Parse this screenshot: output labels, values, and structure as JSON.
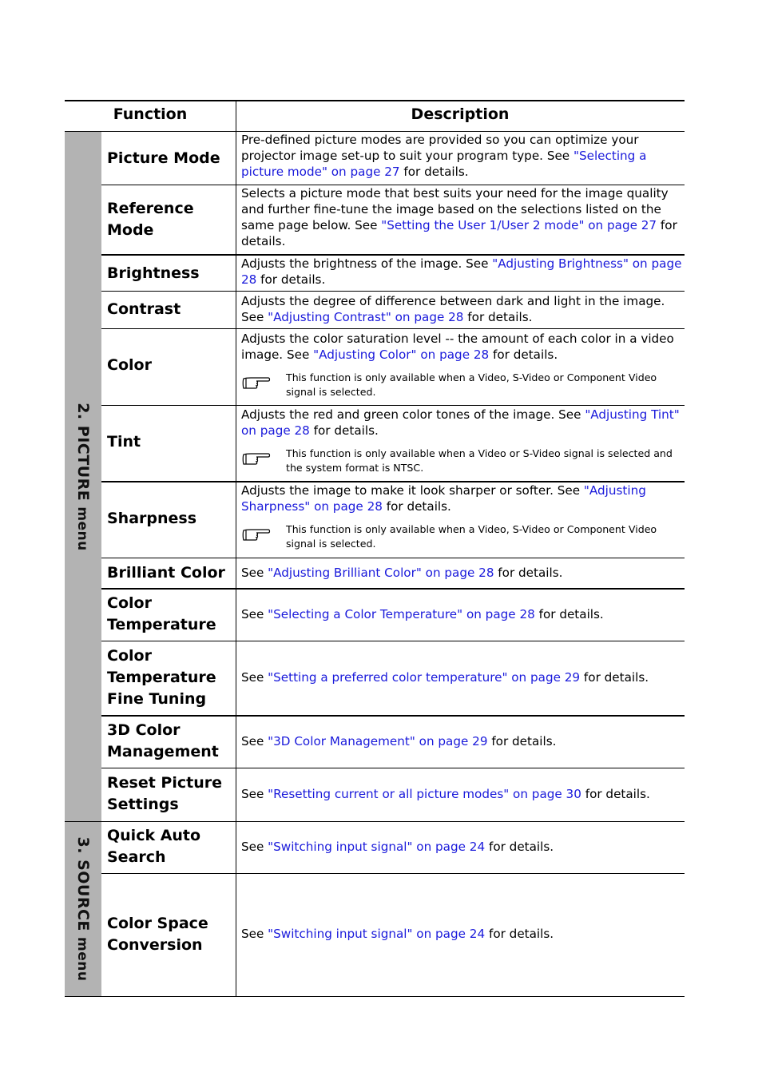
{
  "table": {
    "headers": {
      "function": "Function",
      "description": "Description"
    },
    "sections": [
      {
        "label_main": "2. PICTURE",
        "label_sub": "menu"
      },
      {
        "label_main": "3. SOURCE",
        "label_sub": "menu"
      }
    ],
    "rows": [
      {
        "function": "Picture Mode",
        "pre": "Pre-defined picture modes are provided so you can optimize your projector image set-up to suit your program type. See ",
        "link": "\"Selecting a picture mode\" on page 27",
        "post": " for details."
      },
      {
        "function": "Reference Mode",
        "pre": "Selects a picture mode that best suits your need for the image quality and further fine-tune the image based on the selections listed on the same page below. See ",
        "link": "\"Setting the User 1/User 2 mode\" on page 27",
        "post": " for details."
      },
      {
        "function": "Brightness",
        "pre": "Adjusts the brightness of the image. See ",
        "link": "\"Adjusting Brightness\" on page 28",
        "post": " for details."
      },
      {
        "function": "Contrast",
        "pre": "Adjusts the degree of difference between dark and light in the image. See ",
        "link": "\"Adjusting Contrast\" on page 28",
        "post": " for details."
      },
      {
        "function": "Color",
        "pre": "Adjusts the color saturation level -- the amount of each color in a video image. See ",
        "link": "\"Adjusting Color\" on page 28",
        "post": " for details.",
        "note": "This function is only available when a Video, S-Video or Component Video signal is selected."
      },
      {
        "function": "Tint",
        "pre": "Adjusts the red and green color tones of the image. See ",
        "link": "\"Adjusting Tint\" on page 28",
        "post": " for details.",
        "note": "This function is only available when a Video or S-Video signal is selected and the system format is NTSC."
      },
      {
        "function": "Sharpness",
        "pre": "Adjusts the image to make it look sharper or softer. See ",
        "link": "\"Adjusting Sharpness\" on page 28",
        "post": " for details.",
        "note": "This function is only available when a Video, S-Video or Component Video signal is selected."
      },
      {
        "function": "Brilliant Color",
        "pre": "See ",
        "link": "\"Adjusting Brilliant Color\" on page 28",
        "post": " for details."
      },
      {
        "function": "Color Temperature",
        "pre": "See ",
        "link": "\"Selecting a Color Temperature\" on page 28",
        "post": " for details."
      },
      {
        "function": "Color Temperature Fine Tuning",
        "pre": "See ",
        "link": "\"Setting a preferred color temperature\" on page 29",
        "post": " for details."
      },
      {
        "function": "3D Color Management",
        "pre": "See ",
        "link": "\"3D Color Management\" on page 29",
        "post": " for details."
      },
      {
        "function": "Reset Picture Settings",
        "pre": "See ",
        "link": "\"Resetting current or all picture modes\" on page 30",
        "post": " for details."
      },
      {
        "function": "Quick Auto Search",
        "pre": "See ",
        "link": "\"Switching input signal\" on page 24",
        "post": " for details."
      },
      {
        "function": "Color Space Conversion",
        "pre": "See ",
        "link": "\"Switching input signal\" on page 24",
        "post": " for details."
      }
    ]
  },
  "icons": {
    "note": "pointing-hand-icon"
  },
  "colors": {
    "link": "#1a1adb",
    "sidebar": "#b3b3b3"
  }
}
